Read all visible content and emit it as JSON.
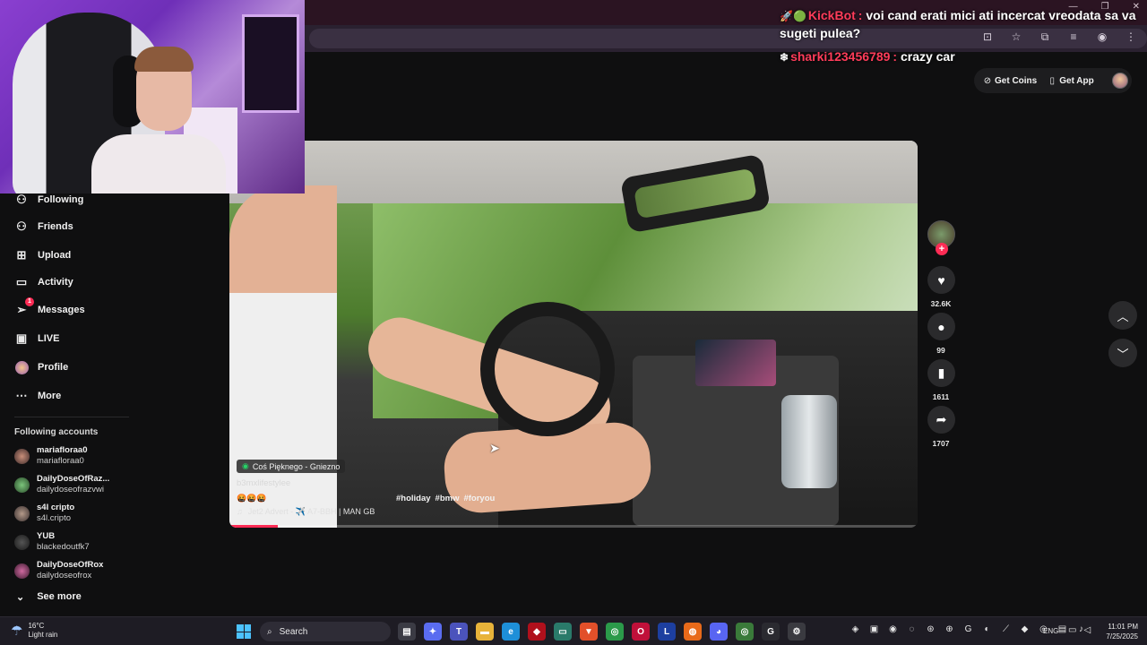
{
  "chat": {
    "messages": [
      {
        "badges": "🚀🟢",
        "user": "KickBot",
        "sep": ":",
        "text": "voi cand erati mici ati incercat vreodata sa va sugeti pulea?",
        "color": "#ff3c5a"
      },
      {
        "badges": "❄",
        "user": "sharki123456789",
        "sep": ":",
        "text": "crazy car",
        "color": "#ff3c5a"
      }
    ]
  },
  "header": {
    "get_coins": "Get Coins",
    "get_app": "Get App"
  },
  "sidebar": {
    "items": [
      {
        "label": "Following",
        "icon": "following-icon"
      },
      {
        "label": "Friends",
        "icon": "friends-icon"
      },
      {
        "label": "Upload",
        "icon": "upload-icon"
      },
      {
        "label": "Activity",
        "icon": "activity-icon"
      },
      {
        "label": "Messages",
        "icon": "messages-icon",
        "badge": "1"
      },
      {
        "label": "LIVE",
        "icon": "live-icon"
      },
      {
        "label": "Profile",
        "icon": "profile-icon"
      },
      {
        "label": "More",
        "icon": "more-icon"
      }
    ],
    "following_title": "Following accounts",
    "accounts": [
      {
        "name": "mariafloraa0",
        "handle": "mariafloraa0"
      },
      {
        "name": "DailyDoseOfRaz...",
        "handle": "dailydoseofrazvwi"
      },
      {
        "name": "s4l cripto",
        "handle": "s4l.cripto"
      },
      {
        "name": "YUB",
        "handle": "blackedoutfk7"
      },
      {
        "name": "DailyDoseOfRox",
        "handle": "dailydoseofrox"
      }
    ],
    "see_more": "See more"
  },
  "video": {
    "location": "Coś Pięknego - Gniezno",
    "username": "b3mxlifestylee",
    "emojis": "🤬🤬🤬",
    "hashtags": [
      "#holiday",
      "#bmw",
      "#foryou"
    ],
    "music": "Jet2 Advert - ✈️ A7-BBH | MAN GB",
    "progress": 0.07
  },
  "actions": {
    "likes": "32.6K",
    "comments": "99",
    "saves": "1611",
    "shares": "1707"
  },
  "taskbar": {
    "temperature": "16°C",
    "weather": "Light rain",
    "search_placeholder": "Search",
    "lang": "ENG",
    "time": "11:01 PM",
    "date": "7/25/2025"
  }
}
